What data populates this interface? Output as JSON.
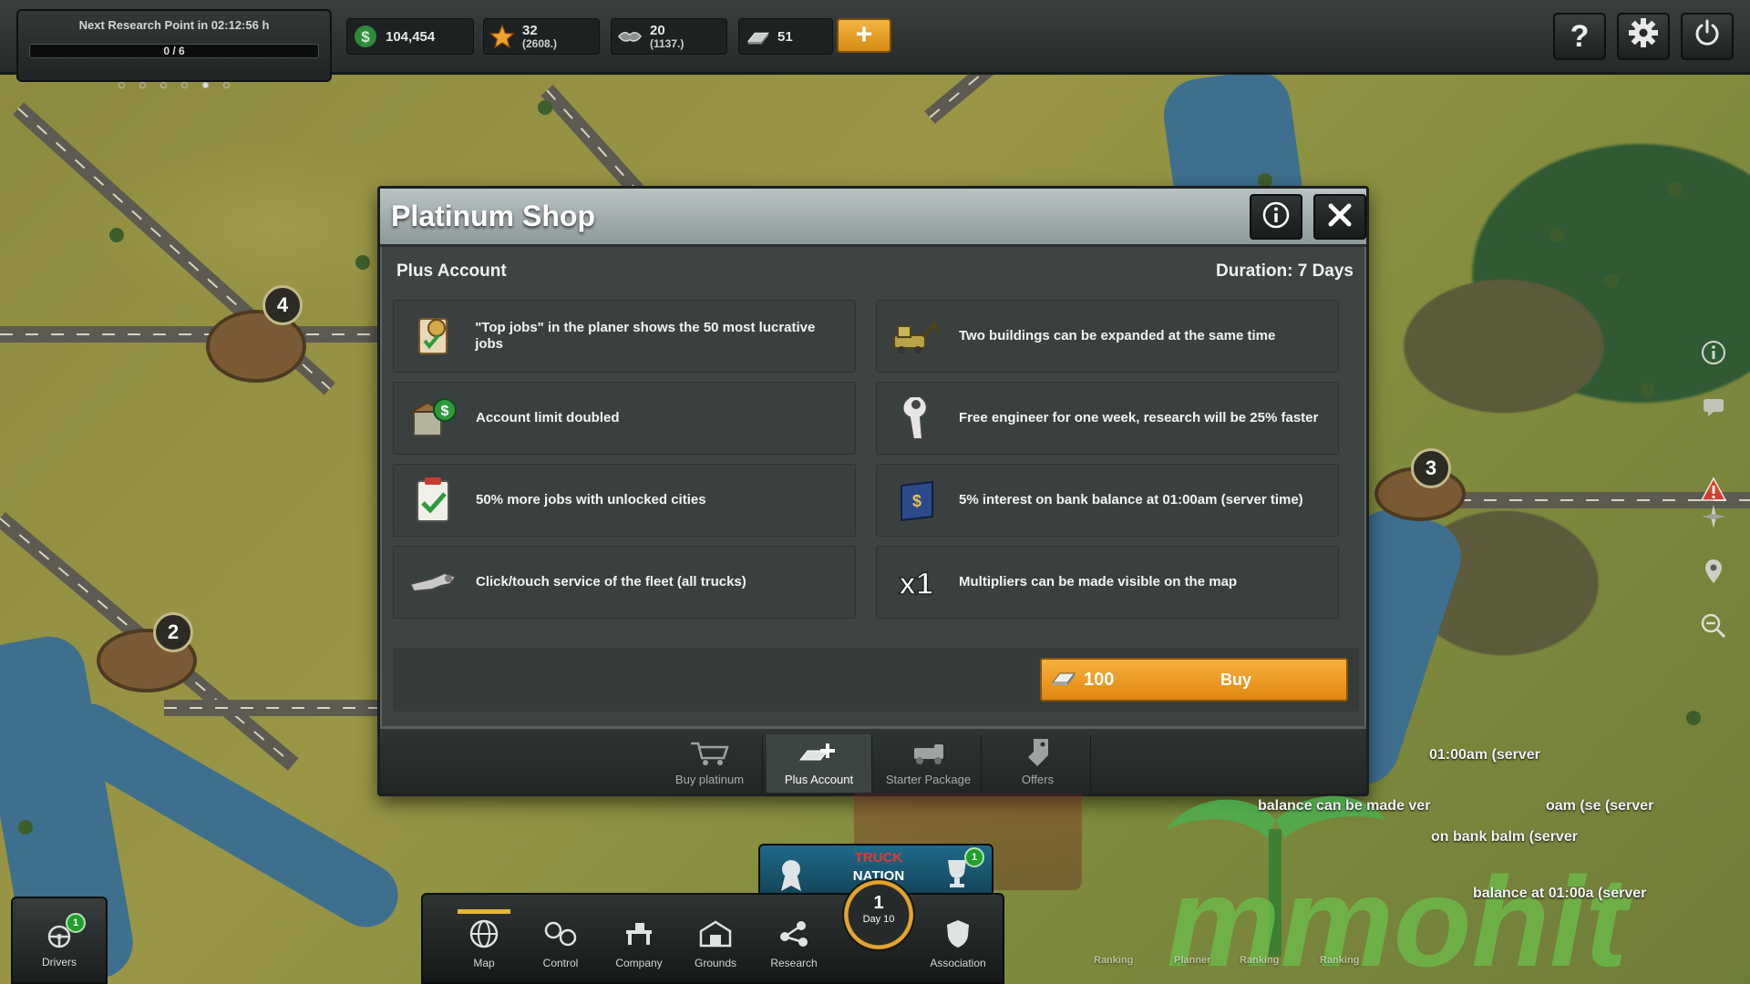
{
  "topbar": {
    "research_label": "Next Research Point in 02:12:56 h",
    "research_progress_text": "0 / 6",
    "research_progress": 0,
    "research_dots": [
      false,
      false,
      false,
      false,
      true,
      false
    ],
    "money": "104,454",
    "prestige": "32",
    "prestige_sub": "(2608.)",
    "reputation": "20",
    "reputation_sub": "(1137.)",
    "platinum": "51",
    "plus_label": "+",
    "help_label": "?"
  },
  "map": {
    "pins": [
      "4",
      "3",
      "2"
    ]
  },
  "shop": {
    "title": "Platinum Shop",
    "section": "Plus Account",
    "duration": "Duration: 7 Days",
    "features": [
      {
        "text": "\"Top jobs\" in the planer shows the 50 most lucrative jobs",
        "icon": "top-jobs-icon"
      },
      {
        "text": "Two buildings can be expanded at the same time",
        "icon": "excavator-icon"
      },
      {
        "text": "Account limit doubled",
        "icon": "bank-money-icon"
      },
      {
        "text": "Free engineer for one week, research will be 25% faster",
        "icon": "engineer-icon"
      },
      {
        "text": "50% more jobs with unlocked cities",
        "icon": "clipboard-check-icon"
      },
      {
        "text": "5% interest on bank balance at 01:00am (server time)",
        "icon": "bank-book-icon"
      },
      {
        "text": "Click/touch service of the fleet (all trucks)",
        "icon": "wrench-icon"
      },
      {
        "text": "Multipliers can be made visible on the map",
        "icon": "multiplier-x1-icon"
      }
    ],
    "price": "100",
    "buy_label": "Buy",
    "tabs": [
      {
        "label": "Buy platinum",
        "icon": "cart-platinum-icon",
        "active": false
      },
      {
        "label": "Plus Account",
        "icon": "platinum-plus-icon",
        "active": true
      },
      {
        "label": "Starter Package",
        "icon": "starter-truck-icon",
        "active": false
      },
      {
        "label": "Offers",
        "icon": "offer-tag-icon",
        "active": false
      }
    ]
  },
  "bottom_nav": {
    "drivers_label": "Drivers",
    "drivers_badge": "1",
    "items": [
      "Map",
      "Control",
      "Company",
      "Grounds",
      "Research",
      "Association"
    ],
    "logo_top": "TRUCK",
    "logo_bottom": "NATION",
    "trophy_badge": "1",
    "day_number": "1",
    "day_label": "Day 10"
  },
  "background_text": {
    "line1": "01:00am (server",
    "line2": "balance can be made ver",
    "line3": "oam (se (server",
    "line4": "on bank balm (server",
    "line5": "balance at 01:00a (server",
    "ghost_tabs": [
      "Ranking",
      "Planner",
      "Ranking",
      "Ranking"
    ],
    "watermark_text": "mmohit"
  },
  "colors": {
    "buy_orange": "#f0a030",
    "header_gray": "#a9b3b3",
    "panel_dark": "#3e4444",
    "badge_green": "#1fa02a"
  }
}
